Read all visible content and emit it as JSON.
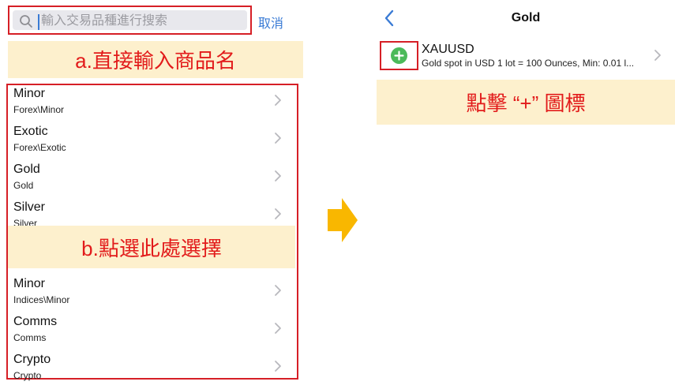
{
  "left_panel": {
    "search": {
      "placeholder": "輸入交易品種進行搜索",
      "value": ""
    },
    "cancel_label": "取消",
    "annotation_a": "a.直接輸入商品名",
    "annotation_b": "b.點選此處選擇",
    "categories": [
      {
        "title": "Minor",
        "subtitle": "Forex\\Minor"
      },
      {
        "title": "Exotic",
        "subtitle": "Forex\\Exotic"
      },
      {
        "title": "Gold",
        "subtitle": "Gold"
      },
      {
        "title": "Silver",
        "subtitle": "Silver"
      },
      {
        "title": "Minor",
        "subtitle": "Indices\\Minor"
      },
      {
        "title": "Comms",
        "subtitle": "Comms"
      },
      {
        "title": "Crypto",
        "subtitle": "Crypto"
      }
    ]
  },
  "right_panel": {
    "nav_title": "Gold",
    "symbol": {
      "name": "XAUUSD",
      "description": "Gold spot in USD 1 lot = 100 Ounces, Min: 0.01 l..."
    },
    "annotation_plus": "點擊 “+” 圖標"
  },
  "colors": {
    "accent_blue": "#3a7bd5",
    "highlight_red": "#d61f26",
    "banner_bg": "#fdf0cd",
    "banner_text": "#e21b1b",
    "add_green": "#4cba5a",
    "arrow_yellow": "#f9b700"
  },
  "icons": [
    "search-icon",
    "chevron-right-icon",
    "back-chevron-icon",
    "plus-icon",
    "arrow-right-icon"
  ]
}
